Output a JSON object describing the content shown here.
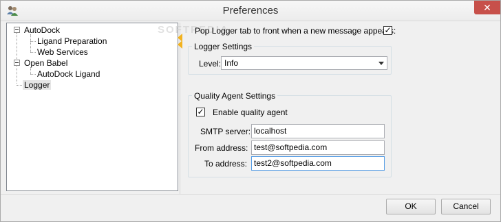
{
  "window": {
    "title": "Preferences",
    "close_glyph": "✕",
    "app_icon": "users-icon"
  },
  "watermark": "SOFTPEDIA",
  "tree": {
    "nodes": [
      {
        "label": "AutoDock",
        "expanded": true
      },
      {
        "label": "Ligand Preparation"
      },
      {
        "label": "Web Services"
      },
      {
        "label": "Open Babel",
        "expanded": true
      },
      {
        "label": "AutoDock Ligand"
      },
      {
        "label": "Logger",
        "selected": true
      }
    ]
  },
  "logger": {
    "pop_to_front_label": "Pop Logger tab to front when a new  message appears:",
    "pop_to_front_checked": true,
    "settings_group_title": "Logger Settings",
    "level_label": "Level:",
    "level_value": "Info"
  },
  "quality_agent": {
    "group_title": "Quality Agent Settings",
    "enable_label": "Enable quality agent",
    "enable_checked": true,
    "smtp_label": "SMTP server:",
    "smtp_value": "localhost",
    "from_label": "From address:",
    "from_value": "test@softpedia.com",
    "to_label": "To address:",
    "to_value": "test2@softpedia.com"
  },
  "buttons": {
    "ok_label": "OK",
    "cancel_label": "Cancel"
  },
  "colors": {
    "selection": "#e5e5e5",
    "close_button": "#c7504a",
    "focus_border": "#569de5",
    "splitter_arrow": "#f2b21f"
  }
}
